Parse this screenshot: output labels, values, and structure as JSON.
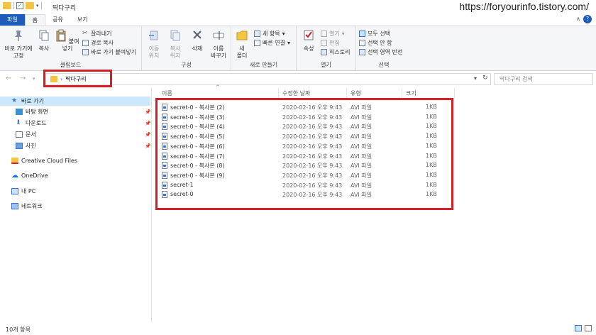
{
  "window": {
    "title": "딱다구리",
    "watermark": "https://foryourinfo.tistory.com/"
  },
  "tabs": [
    "파일",
    "홈",
    "공유",
    "보기"
  ],
  "ribbon": {
    "clipboard": {
      "label": "클립보드",
      "pin_label": "바로 가기에\n고정",
      "copy": "복사",
      "paste": "붙여넣기",
      "cut": "잘라내기",
      "copy_path": "경로 복사",
      "paste_shortcut": "바로 가기 붙여넣기"
    },
    "organize": {
      "label": "구성",
      "move_to": "이동\n위치",
      "copy_to": "복사\n위치",
      "delete": "삭제",
      "rename": "이름\n바꾸기"
    },
    "new": {
      "label": "새로 만들기",
      "new_folder": "새\n폴더",
      "new_item": "새 항목",
      "easy_access": "빠른 연결"
    },
    "open": {
      "label": "열기",
      "properties": "속성",
      "open": "열기",
      "edit": "편집",
      "history": "히스토리"
    },
    "select": {
      "label": "선택",
      "select_all": "모두 선택",
      "select_none": "선택 안 함",
      "invert": "선택 영역 반전"
    }
  },
  "address": {
    "path": "딱다구리",
    "search_placeholder": "딱다구리 검색"
  },
  "navpane": {
    "quick_access": "바로 가기",
    "items": [
      "바탕 화면",
      "다운로드",
      "문서",
      "사진"
    ],
    "creative_cloud": "Creative Cloud Files",
    "onedrive": "OneDrive",
    "this_pc": "내 PC",
    "network": "네트워크"
  },
  "columns": {
    "name": "이름",
    "date": "수정한 날짜",
    "type": "유형",
    "size": "크기"
  },
  "files": [
    {
      "name": "secret-0 - 복사본 (2)",
      "date": "2020-02-16 오후 9:43",
      "type": "AVI 파일",
      "size": "1KB"
    },
    {
      "name": "secret-0 - 복사본 (3)",
      "date": "2020-02-16 오후 9:43",
      "type": "AVI 파일",
      "size": "1KB"
    },
    {
      "name": "secret-0 - 복사본 (4)",
      "date": "2020-02-16 오후 9:43",
      "type": "AVI 파일",
      "size": "1KB"
    },
    {
      "name": "secret-0 - 복사본 (5)",
      "date": "2020-02-16 오후 9:43",
      "type": "AVI 파일",
      "size": "1KB"
    },
    {
      "name": "secret-0 - 복사본 (6)",
      "date": "2020-02-16 오후 9:43",
      "type": "AVI 파일",
      "size": "1KB"
    },
    {
      "name": "secret-0 - 복사본 (7)",
      "date": "2020-02-16 오후 9:43",
      "type": "AVI 파일",
      "size": "1KB"
    },
    {
      "name": "secret-0 - 복사본 (8)",
      "date": "2020-02-16 오후 9:43",
      "type": "AVI 파일",
      "size": "1KB"
    },
    {
      "name": "secret-0 - 복사본 (9)",
      "date": "2020-02-16 오후 9:43",
      "type": "AVI 파일",
      "size": "1KB"
    },
    {
      "name": "secret-1",
      "date": "2020-02-16 오후 9:43",
      "type": "AVI 파일",
      "size": "1KB"
    },
    {
      "name": "secret-0",
      "date": "2020-02-16 오후 9:43",
      "type": "AVI 파일",
      "size": "1KB"
    }
  ],
  "status": {
    "count": "10개 항목"
  },
  "colors": {
    "file_tab": "#1f5bb8",
    "highlight": "#d42027",
    "selection": "#cce8ff",
    "folder": "#f4c542"
  }
}
